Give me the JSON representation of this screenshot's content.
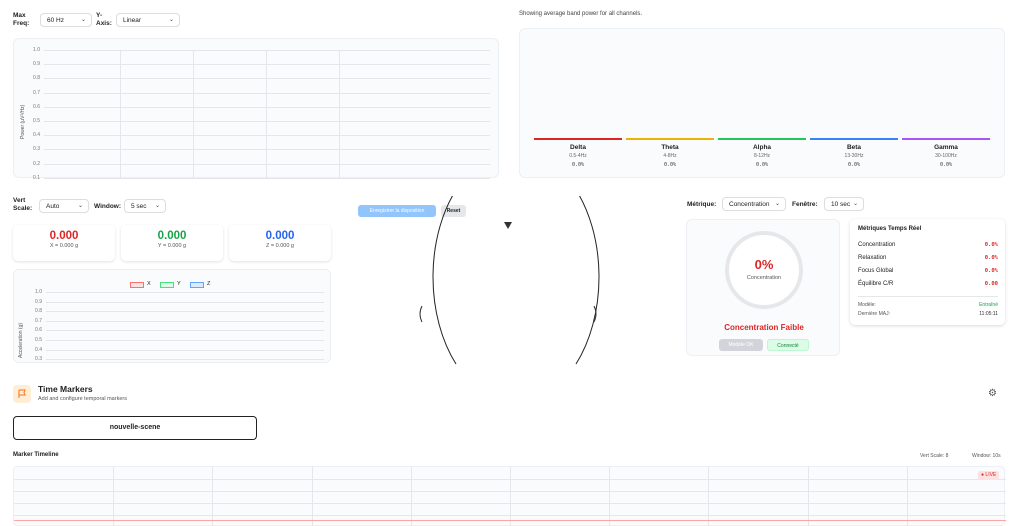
{
  "spectrum": {
    "max_freq_label": "Max Freq:",
    "max_freq_value": "60 Hz",
    "yaxis_label": "Y-Axis:",
    "yaxis_value": "Linear",
    "ylabel": "Power (μV²/Hz)",
    "ticks": [
      "1.0",
      "0.9",
      "0.8",
      "0.7",
      "0.6",
      "0.5",
      "0.4",
      "0.3",
      "0.2",
      "0.1"
    ]
  },
  "bands": {
    "caption": "Showing average band power for all channels.",
    "items": [
      {
        "name": "Delta",
        "range": "0.5-4Hz",
        "value": "0.0%",
        "color": "#dc2626"
      },
      {
        "name": "Theta",
        "range": "4-8Hz",
        "value": "0.0%",
        "color": "#eab308"
      },
      {
        "name": "Alpha",
        "range": "8-12Hz",
        "value": "0.0%",
        "color": "#22c55e"
      },
      {
        "name": "Beta",
        "range": "13-30Hz",
        "value": "0.0%",
        "color": "#3b82f6"
      },
      {
        "name": "Gamma",
        "range": "30-100Hz",
        "value": "0.0%",
        "color": "#a855f7"
      }
    ]
  },
  "accel": {
    "vert_scale_label": "Vert Scale:",
    "vert_scale_value": "Auto",
    "window_label": "Window:",
    "window_value": "5 sec",
    "x": {
      "value": "0.000",
      "sub": "X = 0.000 g",
      "color": "#dc2626"
    },
    "y": {
      "value": "0.000",
      "sub": "Y = 0.000 g",
      "color": "#16a34a"
    },
    "z": {
      "value": "0.000",
      "sub": "Z = 0.000 g",
      "color": "#2563eb"
    },
    "legend": [
      "X",
      "Y",
      "Z"
    ],
    "ylabel": "Acceleration (g)",
    "ticks": [
      "1.0",
      "0.9",
      "0.8",
      "0.7",
      "0.6",
      "0.5",
      "0.4",
      "0.3"
    ]
  },
  "head": {
    "save_label": "Enregistrer la disposition",
    "reset_label": "Reset"
  },
  "metrics": {
    "metric_label": "Métrique:",
    "metric_value": "Concentration",
    "window_label": "Fenêtre:",
    "window_value": "10 sec",
    "gauge_value": "0%",
    "gauge_label": "Concentration",
    "status_text": "Concentration Faible",
    "model_ok_label": "Modèle OK",
    "connected_label": "Connecté",
    "realtime_title": "Métriques Temps Réel",
    "rows": [
      {
        "label": "Concentration",
        "value": "0.0%"
      },
      {
        "label": "Relaxation",
        "value": "0.0%"
      },
      {
        "label": "Focus Global",
        "value": "0.0%"
      },
      {
        "label": "Équilibre C/R",
        "value": "0.00"
      }
    ],
    "model_label": "Modèle:",
    "model_value": "Entraîné",
    "last_update_label": "Dernière MAJ:",
    "last_update_value": "11:05:11"
  },
  "markers": {
    "title": "Time Markers",
    "subtitle": "Add and configure temporal markers",
    "scene_button": "nouvelle-scene",
    "timeline_title": "Marker Timeline",
    "vert_scale": "Vert Scale: 8",
    "window": "Window: 10s",
    "live": "● LIVE"
  }
}
